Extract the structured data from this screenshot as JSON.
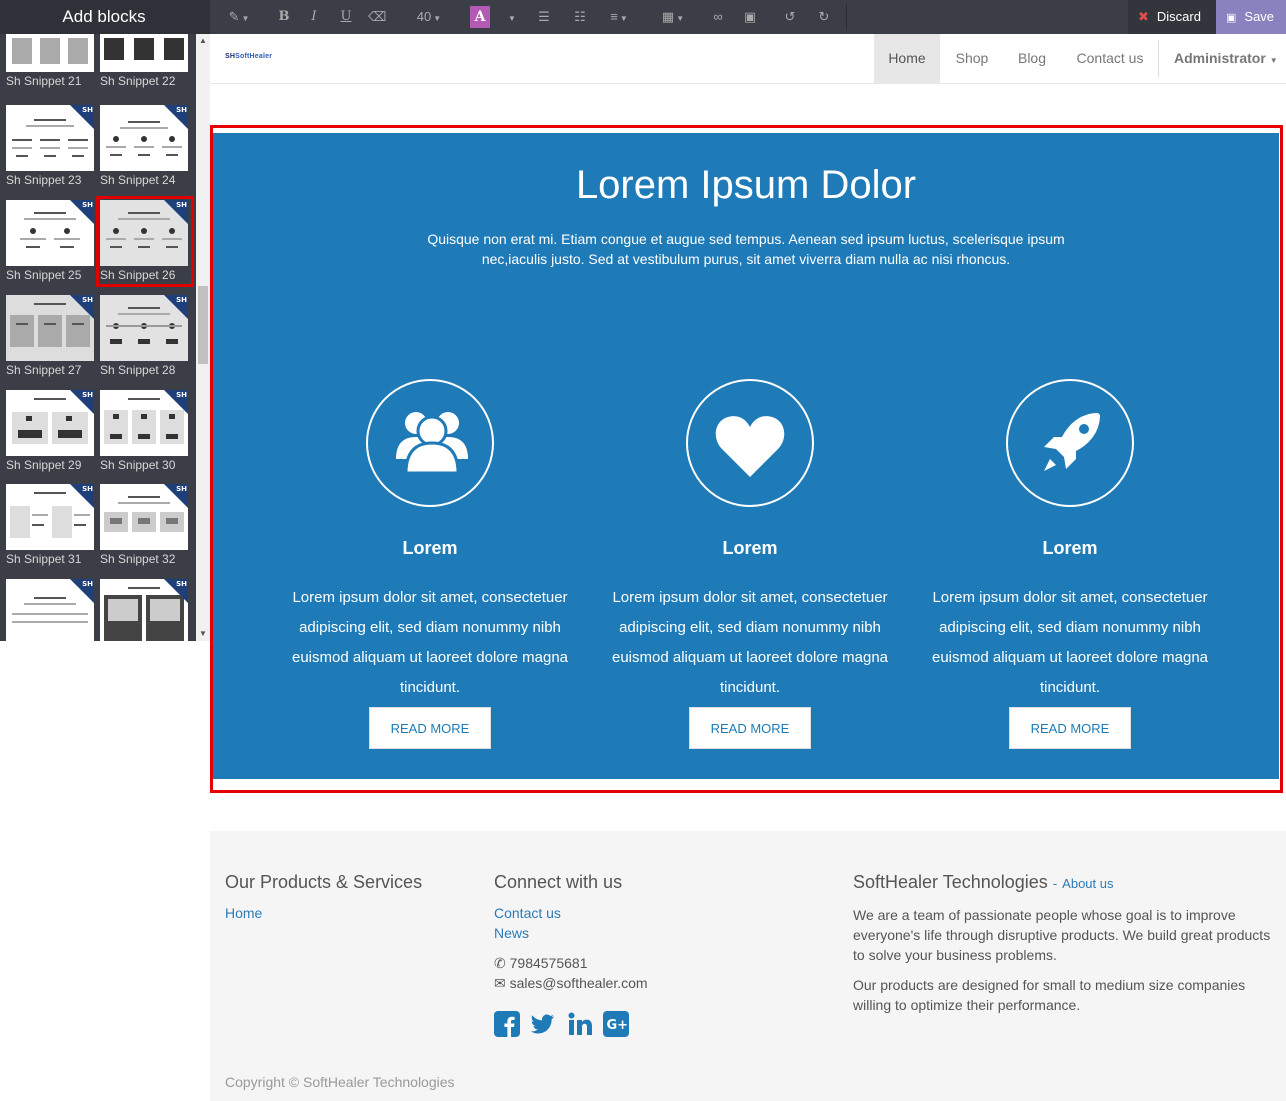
{
  "sidebar": {
    "title": "Add blocks",
    "snippets": [
      "Sh Snippet 21",
      "Sh Snippet 22",
      "Sh Snippet 23",
      "Sh Snippet 24",
      "Sh Snippet 25",
      "Sh Snippet 26",
      "Sh Snippet 27",
      "Sh Snippet 28",
      "Sh Snippet 29",
      "Sh Snippet 30",
      "Sh Snippet 31",
      "Sh Snippet 32"
    ],
    "ribbon": "SH",
    "selected": "Sh Snippet 26"
  },
  "toolbar": {
    "bold": "B",
    "italic": "I",
    "underline": "U",
    "font_size": "40",
    "color_letter": "A",
    "discard_label": "Discard",
    "save_label": "Save"
  },
  "navbar": {
    "logo_prefix": "SH",
    "logo_text": "SoftHealer",
    "items": [
      "Home",
      "Shop",
      "Blog",
      "Contact us"
    ],
    "active": "Home",
    "user": "Administrator"
  },
  "hero": {
    "title": "Lorem Ipsum Dolor",
    "subtitle": "Quisque non erat mi. Etiam congue et augue sed tempus. Aenean sed ipsum luctus, scelerisque ipsum nec,iaculis justo. Sed at vestibulum purus, sit amet viverra diam nulla ac nisi rhoncus.",
    "features": [
      {
        "icon": "users-icon",
        "title": "Lorem",
        "text": "Lorem ipsum dolor sit amet, consectetuer adipiscing elit, sed diam nonummy nibh euismod aliquam ut laoreet dolore magna tincidunt.",
        "button": "READ MORE"
      },
      {
        "icon": "heart-icon",
        "title": "Lorem",
        "text": "Lorem ipsum dolor sit amet, consectetuer adipiscing elit, sed diam nonummy nibh euismod aliquam ut laoreet dolore magna tincidunt.",
        "button": "READ MORE"
      },
      {
        "icon": "rocket-icon",
        "title": "Lorem",
        "text": "Lorem ipsum dolor sit amet, consectetuer adipiscing elit, sed diam nonummy nibh euismod aliquam ut laoreet dolore magna tincidunt.",
        "button": "READ MORE"
      }
    ],
    "background": "#1f7bb8"
  },
  "footer": {
    "products_title": "Our Products & Services",
    "products_links": [
      "Home"
    ],
    "connect_title": "Connect with us",
    "connect_links": [
      "Contact us",
      "News"
    ],
    "phone": "7984575681",
    "email": "sales@softhealer.com",
    "company_title": "SoftHealer Technologies",
    "company_sep": "-",
    "about_link": "About us",
    "company_p1": "We are a team of passionate people whose goal is to improve everyone's life through disruptive products. We build great products to solve your business problems.",
    "company_p2": "Our products are designed for small to medium size companies willing to optimize their performance.",
    "copyright": "Copyright © SoftHealer Technologies"
  },
  "colors": {
    "accent": "#1f7bb8",
    "selection": "#e60000",
    "save": "#8a82bf",
    "toolbar": "#3b3e46"
  }
}
